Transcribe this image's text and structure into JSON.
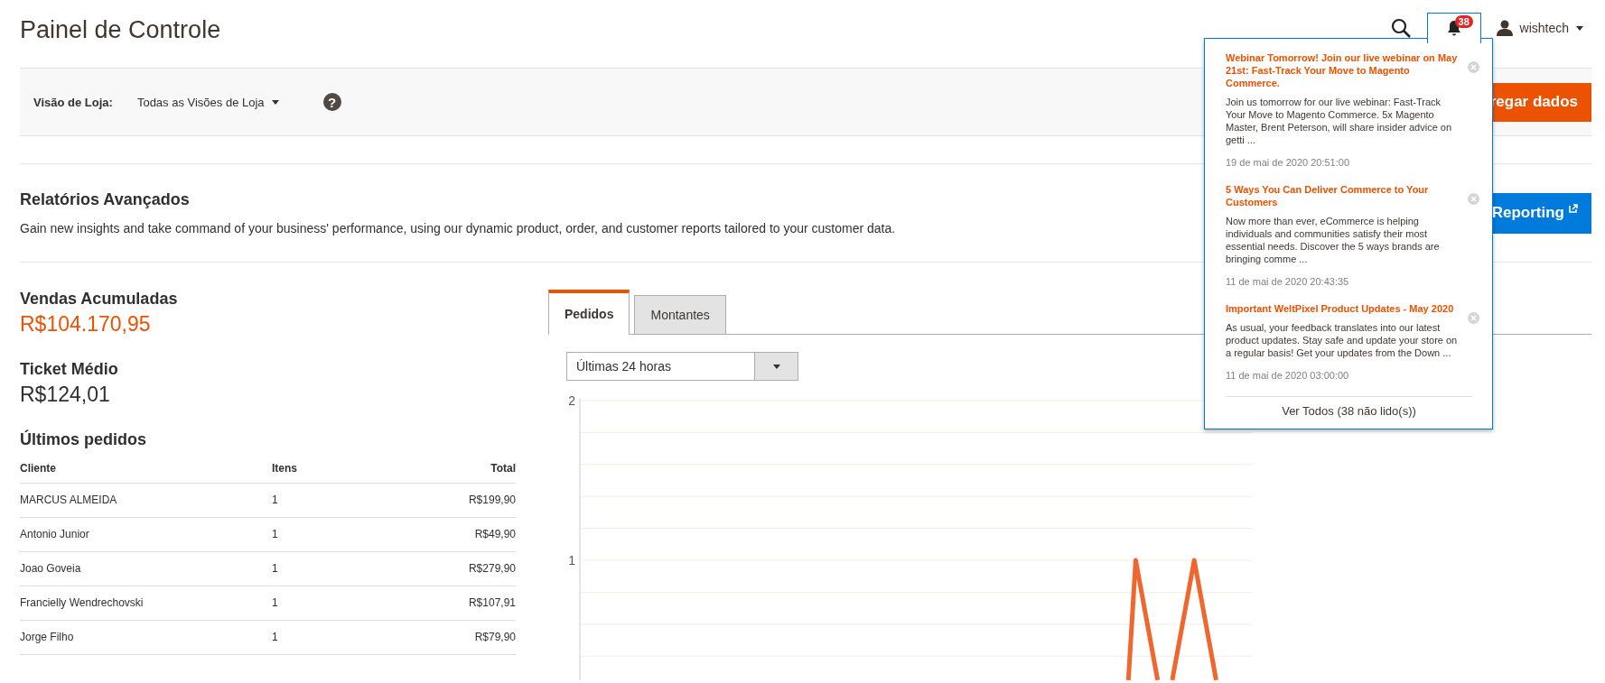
{
  "header": {
    "title": "Painel de Controle",
    "notification_count": "38",
    "user": "wishtech"
  },
  "store_view": {
    "label": "Visão de Loja:",
    "value": "Todas as Visões de Loja",
    "help": "?"
  },
  "reload_button": "regar dados",
  "advanced_reporting": {
    "title": "Relatórios Avançados",
    "description": "Gain new insights and take command of your business' performance, using our dynamic product, order, and customer reports tailored to your customer data.",
    "button": "Reporting"
  },
  "stats": [
    {
      "label": "Vendas Acumuladas",
      "value": "R$104.170,95",
      "kind": "highlight"
    },
    {
      "label": "Ticket Médio",
      "value": "R$124,01",
      "kind": "plain"
    }
  ],
  "last_orders": {
    "title": "Últimos pedidos",
    "columns": [
      "Cliente",
      "Itens",
      "Total"
    ],
    "rows": [
      [
        "MARCUS ALMEIDA",
        "1",
        "R$199,90"
      ],
      [
        "Antonio Junior",
        "1",
        "R$49,90"
      ],
      [
        "Joao Goveia",
        "1",
        "R$279,90"
      ],
      [
        "Francielly Wendrechovski",
        "1",
        "R$107,91"
      ],
      [
        "Jorge Filho",
        "1",
        "R$79,90"
      ]
    ]
  },
  "tabs": [
    {
      "label": "Pedidos",
      "selected": true
    },
    {
      "label": "Montantes",
      "selected": false
    }
  ],
  "period_select": {
    "value": "Últimas 24 horas"
  },
  "chart": {
    "y_labels": [
      "2",
      "1"
    ]
  },
  "notifications": {
    "items": [
      {
        "title": "Webinar Tomorrow! Join our live webinar on May 21st: Fast-Track Your Move to Magento Commerce.",
        "body": "Join us tomorrow for our live webinar: Fast-Track Your Move to Magento Commerce. 5x Magento Master, Brent Peterson, will share insider advice on getti ...",
        "date": "19 de mai de 2020 20:51:00"
      },
      {
        "title": "5 Ways You Can Deliver Commerce to Your Customers",
        "body": "Now more than ever, eCommerce is helping individuals and communities satisfy their most essential needs. Discover the 5 ways brands are bringing comme ...",
        "date": "11 de mai de 2020 20:43:35"
      },
      {
        "title": "Important WeltPixel Product Updates - May 2020",
        "body": "As usual, your feedback translates into our latest product updates. Stay safe and update your store on a regular basis! Get your updates from the Down ...",
        "date": "11 de mai de 2020 03:00:00"
      }
    ],
    "footer": "Ver Todos (38 não lido(s))"
  }
}
